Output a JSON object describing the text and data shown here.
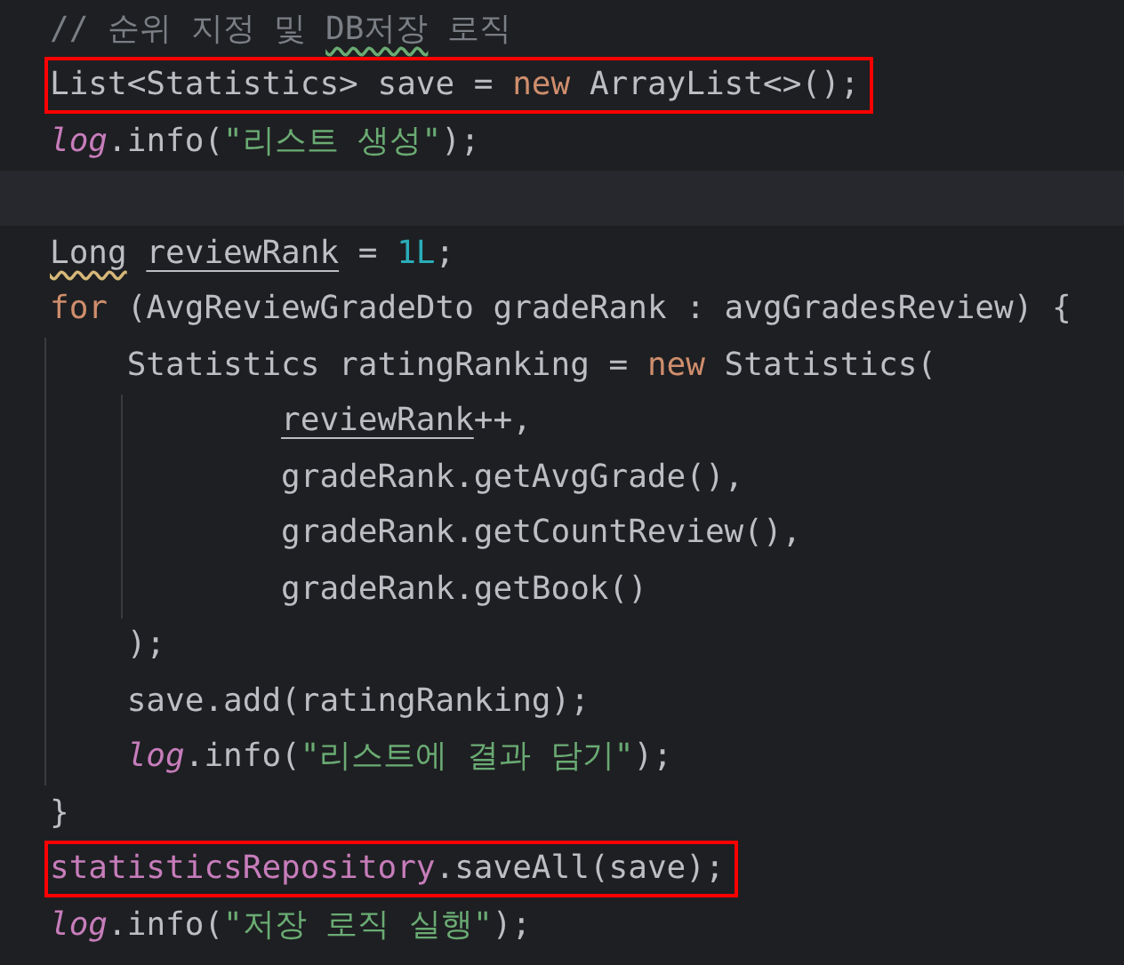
{
  "code_lines": [
    {
      "tokens": [
        {
          "text": "// 순위 지정 및 ",
          "kind": "comment"
        },
        {
          "text": "DB저장",
          "kind": "comment",
          "spelling_issue": true
        },
        {
          "text": " 로직",
          "kind": "comment"
        }
      ]
    },
    {
      "boxed": true,
      "tokens": [
        {
          "text": "List<Statistics> save = ",
          "kind": "plain"
        },
        {
          "text": "new",
          "kind": "keyword"
        },
        {
          "text": " ArrayList<>();",
          "kind": "plain"
        }
      ]
    },
    {
      "tokens": [
        {
          "text": "log",
          "kind": "static"
        },
        {
          "text": ".info(",
          "kind": "plain"
        },
        {
          "text": "\"리스트 생성\"",
          "kind": "string"
        },
        {
          "text": ");",
          "kind": "plain"
        }
      ]
    },
    {
      "current": true
    },
    {
      "tokens": [
        {
          "text": "Long",
          "kind": "plain",
          "weak_warning": true
        },
        {
          "text": "reviewRank",
          "kind": "plain",
          "underline": true,
          "space_before": true
        },
        {
          "text": " = ",
          "kind": "plain"
        },
        {
          "text": "1L",
          "kind": "number"
        },
        {
          "text": ";",
          "kind": "plain"
        }
      ]
    },
    {
      "tokens": [
        {
          "text": "for",
          "kind": "keyword"
        },
        {
          "text": " (AvgReviewGradeDto gradeRank : avgGradesReview) {",
          "kind": "plain"
        }
      ],
      "children": [
        {
          "continuation": true,
          "tokens": [
            {
              "text": "Statistics ratingRanking = ",
              "kind": "plain"
            },
            {
              "text": "new",
              "kind": "keyword"
            },
            {
              "text": " Statistics(",
              "kind": "plain"
            }
          ],
          "children": [
            {
              "tokens": [
                {
                  "text": "reviewRank",
                  "kind": "plain",
                  "underline": true
                },
                {
                  "text": "++,",
                  "kind": "plain"
                }
              ]
            },
            {
              "tokens": [
                {
                  "text": "gradeRank.getAvgGrade(),",
                  "kind": "plain"
                }
              ]
            },
            {
              "tokens": [
                {
                  "text": "gradeRank.getCountReview(),",
                  "kind": "plain"
                }
              ]
            },
            {
              "tokens": [
                {
                  "text": "gradeRank.getBook()",
                  "kind": "plain"
                }
              ]
            }
          ]
        },
        {
          "tokens": [
            {
              "text": ");",
              "kind": "plain"
            }
          ]
        },
        {
          "tokens": [
            {
              "text": "save.add(ratingRanking);",
              "kind": "plain"
            }
          ]
        },
        {
          "tokens": [
            {
              "text": "log",
              "kind": "static"
            },
            {
              "text": ".info(",
              "kind": "plain"
            },
            {
              "text": "\"리스트에 결과 담기\"",
              "kind": "string"
            },
            {
              "text": ");",
              "kind": "plain"
            }
          ]
        }
      ]
    },
    {
      "tokens": [
        {
          "text": "}",
          "kind": "plain"
        }
      ]
    },
    {
      "boxed": true,
      "tokens": [
        {
          "text": "statisticsRepository",
          "kind": "field"
        },
        {
          "text": ".saveAll(save);",
          "kind": "plain"
        }
      ]
    },
    {
      "tokens": [
        {
          "text": "log",
          "kind": "static"
        },
        {
          "text": ".info(",
          "kind": "plain"
        },
        {
          "text": "\"저장 로직 실행\"",
          "kind": "string"
        },
        {
          "text": ");",
          "kind": "plain"
        }
      ]
    }
  ]
}
